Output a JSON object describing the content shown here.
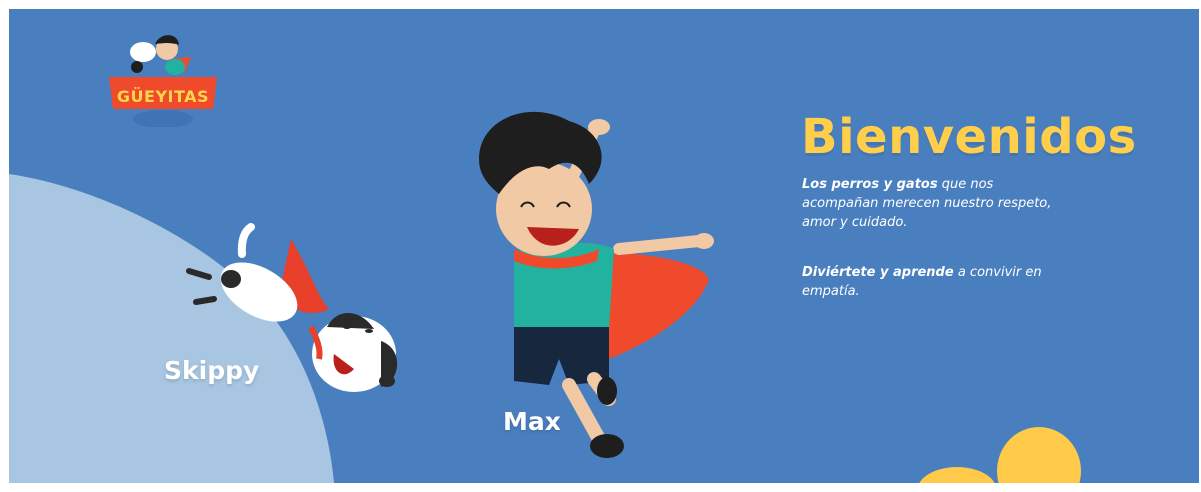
{
  "brand": {
    "logo_text": "GÜEYITAS"
  },
  "hero": {
    "title": "Bienvenidos",
    "paragraph1": {
      "part1": "Los perros y gatos",
      "part2": " que nos acompañan merecen nuestro respeto, amor y cuidado."
    },
    "paragraph2": {
      "part1": "Diviértete y aprende",
      "part2": " a convivir en empatía."
    },
    "characters": {
      "dog_name": "Skippy",
      "boy_name": "Max"
    }
  },
  "colors": {
    "background": "#4a7fbf",
    "title": "#ffce4a",
    "wave": "#a8c6e2",
    "cape": "#ef4a2c",
    "shirt": "#22b3a0",
    "blobs": "#ffc94a"
  }
}
